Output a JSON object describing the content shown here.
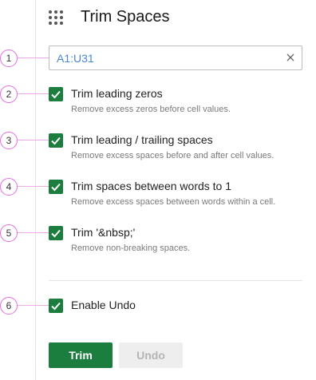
{
  "header": {
    "title": "Trim Spaces",
    "apps_icon": "grid-icon"
  },
  "range": {
    "value": "A1:U31",
    "clear_icon": "close-icon"
  },
  "options": [
    {
      "label": "Trim leading zeros",
      "description": "Remove excess zeros before cell values.",
      "checked": true
    },
    {
      "label": "Trim leading / trailing spaces",
      "description": "Remove excess spaces before and after cell values.",
      "checked": true
    },
    {
      "label": "Trim spaces between words to 1",
      "description": "Remove excess spaces between words within a cell.",
      "checked": true
    },
    {
      "label": "Trim '&nbsp;'",
      "description": "Remove non-breaking spaces.",
      "checked": true
    }
  ],
  "undo_option": {
    "label": "Enable Undo",
    "checked": true
  },
  "buttons": {
    "trim": "Trim",
    "undo": "Undo",
    "undo_disabled": true
  },
  "callouts": [
    "1",
    "2",
    "3",
    "4",
    "5",
    "6"
  ],
  "colors": {
    "accent_green": "#1b7d3e",
    "callout_pink": "#e66ee0",
    "range_text": "#4a86d4"
  }
}
